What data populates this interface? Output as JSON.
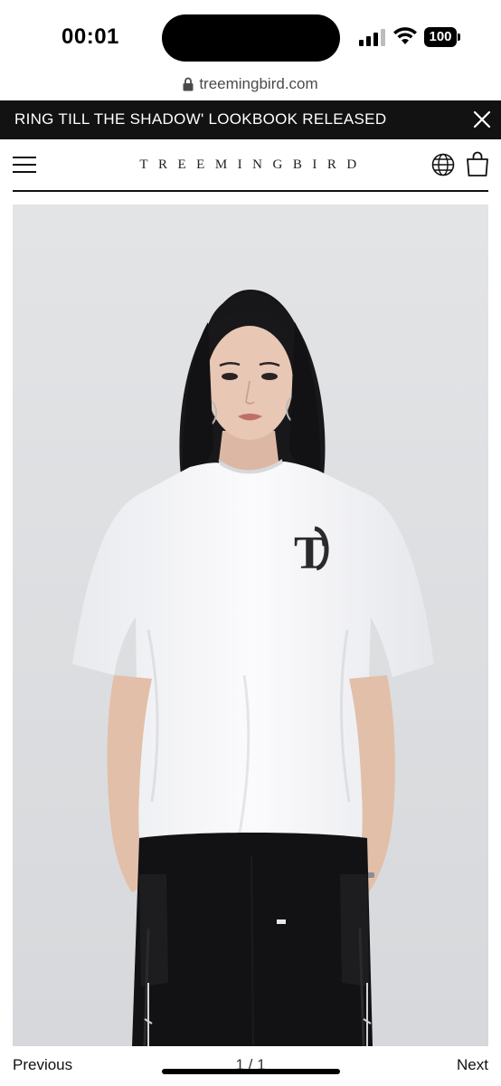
{
  "status_bar": {
    "time": "00:01",
    "battery": "100"
  },
  "browser": {
    "url": "treemingbird.com"
  },
  "announcement": {
    "text": "RING TILL THE SHADOW' LOOKBOOK RELEASED"
  },
  "header": {
    "logo": "TREEMINGBIRD",
    "icons": [
      "menu-icon",
      "globe-icon",
      "shopping-bag-icon"
    ]
  },
  "product": {
    "shirt_logo": "T"
  },
  "pager": {
    "previous_label": "Previous",
    "page_count": "1 / 1",
    "next_label": "Next"
  },
  "colors": {
    "announcement_bg": "#121212",
    "photo_bg": "#e7e8ea"
  }
}
